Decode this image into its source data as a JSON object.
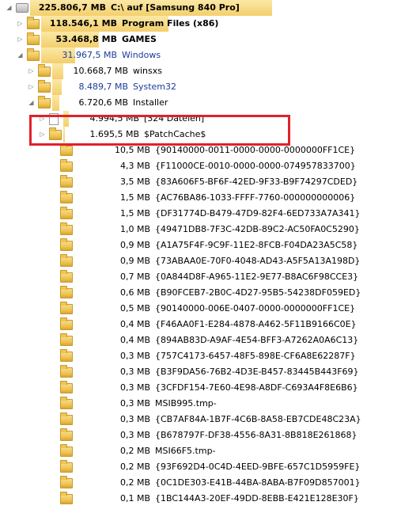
{
  "rows": [
    {
      "size": "225.806,7 MB",
      "name": "C:\\  auf  [Samsung 840 Pro]",
      "level": 0,
      "icon": "drive",
      "expander": "expanded",
      "bar": 1.0,
      "bold": true,
      "blue": false
    },
    {
      "size": "118.546,1 MB",
      "name": "Program Files (x86)",
      "level": 1,
      "icon": "folder",
      "expander": "collapsed",
      "bar": 0.525,
      "bold": true,
      "blue": false
    },
    {
      "size": "53.468,8 MB",
      "name": "GAMES",
      "level": 1,
      "icon": "folder",
      "expander": "collapsed",
      "bar": 0.237,
      "bold": true,
      "blue": false
    },
    {
      "size": "31.967,5 MB",
      "name": "Windows",
      "level": 1,
      "icon": "folder",
      "expander": "expanded",
      "bar": 0.142,
      "bold": false,
      "blue": true
    },
    {
      "size": "10.668,7 MB",
      "name": "winsxs",
      "level": 2,
      "icon": "folder",
      "expander": "collapsed",
      "bar": 0.047,
      "bold": false,
      "blue": false
    },
    {
      "size": "8.489,7 MB",
      "name": "System32",
      "level": 2,
      "icon": "folder",
      "expander": "collapsed",
      "bar": 0.038,
      "bold": false,
      "blue": true
    },
    {
      "size": "6.720,6 MB",
      "name": "Installer",
      "level": 2,
      "icon": "folder",
      "expander": "expanded",
      "bar": 0.03,
      "bold": false,
      "blue": false
    },
    {
      "size": "4.994,5 MB",
      "name": "[324 Dateien]",
      "level": 3,
      "icon": "file",
      "expander": "collapsed",
      "bar": 0.022,
      "bold": false,
      "blue": false
    },
    {
      "size": "1.695,5 MB",
      "name": "$PatchCache$",
      "level": 3,
      "icon": "folder",
      "expander": "collapsed",
      "bar": 0.0075,
      "bold": false,
      "blue": false
    },
    {
      "size": "10,5 MB",
      "name": "{90140000-0011-0000-0000-0000000FF1CE}",
      "level": 4,
      "icon": "folder",
      "expander": "none",
      "bar": 0,
      "bold": false,
      "blue": false
    },
    {
      "size": "4,3 MB",
      "name": "{F11000CE-0010-0000-0000-074957833700}",
      "level": 4,
      "icon": "folder",
      "expander": "none",
      "bar": 0,
      "bold": false,
      "blue": false
    },
    {
      "size": "3,5 MB",
      "name": "{83A606F5-BF6F-42ED-9F33-B9F74297CDED}",
      "level": 4,
      "icon": "folder",
      "expander": "none",
      "bar": 0,
      "bold": false,
      "blue": false
    },
    {
      "size": "1,5 MB",
      "name": "{AC76BA86-1033-FFFF-7760-000000000006}",
      "level": 4,
      "icon": "folder",
      "expander": "none",
      "bar": 0,
      "bold": false,
      "blue": false
    },
    {
      "size": "1,5 MB",
      "name": "{DF31774D-B479-47D9-82F4-6ED733A7A341}",
      "level": 4,
      "icon": "folder",
      "expander": "none",
      "bar": 0,
      "bold": false,
      "blue": false
    },
    {
      "size": "1,0 MB",
      "name": "{49471DB8-7F3C-42DB-89C2-AC50FA0C5290}",
      "level": 4,
      "icon": "folder",
      "expander": "none",
      "bar": 0,
      "bold": false,
      "blue": false
    },
    {
      "size": "0,9 MB",
      "name": "{A1A75F4F-9C9F-11E2-8FCB-F04DA23A5C58}",
      "level": 4,
      "icon": "folder",
      "expander": "none",
      "bar": 0,
      "bold": false,
      "blue": false
    },
    {
      "size": "0,9 MB",
      "name": "{73ABAA0E-70F0-4048-AD43-A5F5A13A198D}",
      "level": 4,
      "icon": "folder",
      "expander": "none",
      "bar": 0,
      "bold": false,
      "blue": false
    },
    {
      "size": "0,7 MB",
      "name": "{0A844D8F-A965-11E2-9E77-B8AC6F98CCE3}",
      "level": 4,
      "icon": "folder",
      "expander": "none",
      "bar": 0,
      "bold": false,
      "blue": false
    },
    {
      "size": "0,6 MB",
      "name": "{B90FCEB7-2B0C-4D27-95B5-54238DF059ED}",
      "level": 4,
      "icon": "folder",
      "expander": "none",
      "bar": 0,
      "bold": false,
      "blue": false
    },
    {
      "size": "0,5 MB",
      "name": "{90140000-006E-0407-0000-0000000FF1CE}",
      "level": 4,
      "icon": "folder",
      "expander": "none",
      "bar": 0,
      "bold": false,
      "blue": false
    },
    {
      "size": "0,4 MB",
      "name": "{F46AA0F1-E284-4878-A462-5F11B9166C0E}",
      "level": 4,
      "icon": "folder",
      "expander": "none",
      "bar": 0,
      "bold": false,
      "blue": false
    },
    {
      "size": "0,4 MB",
      "name": "{894AB83D-A9AF-4E54-BFF3-A7262A0A6C13}",
      "level": 4,
      "icon": "folder",
      "expander": "none",
      "bar": 0,
      "bold": false,
      "blue": false
    },
    {
      "size": "0,3 MB",
      "name": "{757C4173-6457-48F5-898E-CF6A8E62287F}",
      "level": 4,
      "icon": "folder",
      "expander": "none",
      "bar": 0,
      "bold": false,
      "blue": false
    },
    {
      "size": "0,3 MB",
      "name": "{B3F9DA56-76B2-4D3E-B457-83445B443F69}",
      "level": 4,
      "icon": "folder",
      "expander": "none",
      "bar": 0,
      "bold": false,
      "blue": false
    },
    {
      "size": "0,3 MB",
      "name": "{3CFDF154-7E60-4E98-A8DF-C693A4F8E6B6}",
      "level": 4,
      "icon": "folder",
      "expander": "none",
      "bar": 0,
      "bold": false,
      "blue": false
    },
    {
      "size": "0,3 MB",
      "name": "MSIB995.tmp-",
      "level": 4,
      "icon": "folder",
      "expander": "none",
      "bar": 0,
      "bold": false,
      "blue": false
    },
    {
      "size": "0,3 MB",
      "name": "{CB7AF84A-1B7F-4C6B-8A58-EB7CDE48C23A}",
      "level": 4,
      "icon": "folder",
      "expander": "none",
      "bar": 0,
      "bold": false,
      "blue": false
    },
    {
      "size": "0,3 MB",
      "name": "{B678797F-DF38-4556-8A31-8B818E261868}",
      "level": 4,
      "icon": "folder",
      "expander": "none",
      "bar": 0,
      "bold": false,
      "blue": false
    },
    {
      "size": "0,2 MB",
      "name": "MSI66F5.tmp-",
      "level": 4,
      "icon": "folder",
      "expander": "none",
      "bar": 0,
      "bold": false,
      "blue": false
    },
    {
      "size": "0,2 MB",
      "name": "{93F692D4-0C4D-4EED-9BFE-657C1D5959FE}",
      "level": 4,
      "icon": "folder",
      "expander": "none",
      "bar": 0,
      "bold": false,
      "blue": false
    },
    {
      "size": "0,2 MB",
      "name": "{0C1DE303-E41B-44BA-8ABA-B7F09D857001}",
      "level": 4,
      "icon": "folder",
      "expander": "none",
      "bar": 0,
      "bold": false,
      "blue": false
    },
    {
      "size": "0,1 MB",
      "name": "{1BC144A3-20EF-49DD-8EBB-E421E128E30F}",
      "level": 4,
      "icon": "folder",
      "expander": "none",
      "bar": 0,
      "bold": false,
      "blue": false
    }
  ],
  "colors": {
    "bar": "#fbe8a6",
    "bar_top": "#f3cf6d",
    "highlight": "#e0212b",
    "link": "#1a3c9a"
  }
}
